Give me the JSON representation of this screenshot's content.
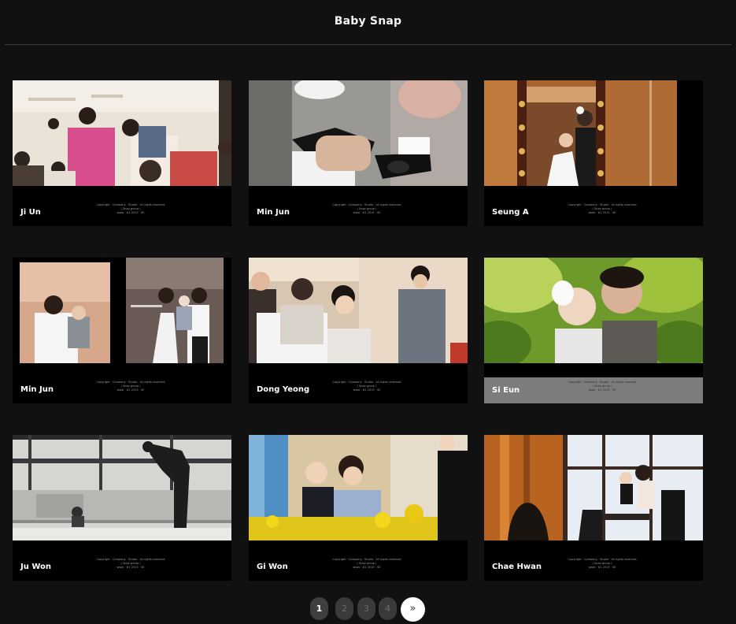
{
  "page": {
    "title": "Baby Snap"
  },
  "colors": {
    "background": "#121112",
    "card": "#000000",
    "accent": "#ffffff"
  },
  "copyright": {
    "line1": "Copyright · Company · Studio ·  All rights reserved",
    "line2": "( Snap group )",
    "line3": "www · #1 2015 ·  SE"
  },
  "gallery": [
    {
      "name": "Ji Un",
      "caption_style": "dark"
    },
    {
      "name": "Min Jun",
      "caption_style": "dark"
    },
    {
      "name": "Seung A",
      "caption_style": "dark"
    },
    {
      "name": "Min Jun",
      "caption_style": "dark"
    },
    {
      "name": "Dong Yeong",
      "caption_style": "dark"
    },
    {
      "name": "Si Eun",
      "caption_style": "grey"
    },
    {
      "name": "Ju Won",
      "caption_style": "dark"
    },
    {
      "name": "Gi Won",
      "caption_style": "dark"
    },
    {
      "name": "Chae Hwan",
      "caption_style": "dark"
    }
  ],
  "pagination": {
    "pages": [
      "1",
      "2",
      "3",
      "4"
    ],
    "current": "1",
    "next_label": "»"
  }
}
